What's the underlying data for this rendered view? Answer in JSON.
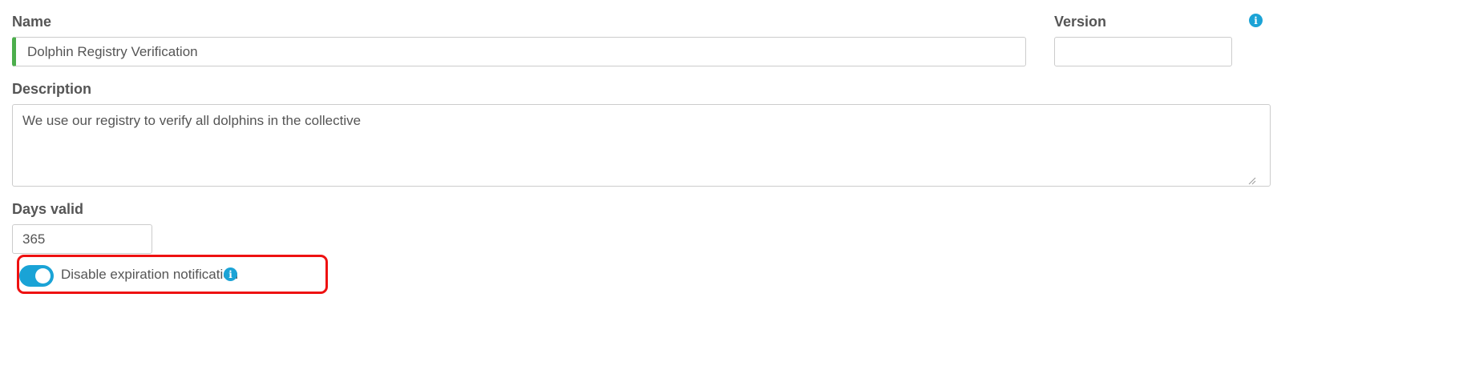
{
  "form": {
    "name": {
      "label": "Name",
      "value": "Dolphin Registry Verification"
    },
    "version": {
      "label": "Version",
      "value": ""
    },
    "description": {
      "label": "Description",
      "value": "We use our registry to verify all dolphins in the collective"
    },
    "days_valid": {
      "label": "Days valid",
      "value": "365"
    },
    "expiration_toggle": {
      "label": "Disable expiration notification",
      "checked": true
    }
  },
  "icons": {
    "info_glyph": "i"
  },
  "colors": {
    "accent": "#1aa3d6",
    "valid_indicator": "#4cae4c",
    "highlight": "#ee1111",
    "text": "#555555",
    "border": "#cccccc"
  }
}
